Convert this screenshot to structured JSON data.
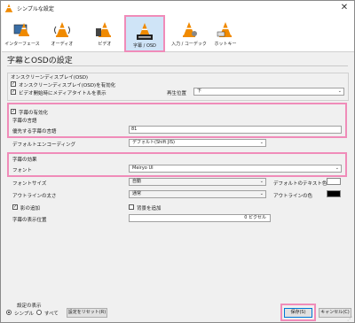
{
  "window": {
    "title": "シンプルな設定"
  },
  "toolbar": {
    "items": [
      {
        "label": "インターフェース"
      },
      {
        "label": "オーディオ"
      },
      {
        "label": "ビデオ"
      },
      {
        "label": "字幕 / OSD"
      },
      {
        "label": "入力 / コーデック"
      },
      {
        "label": "ホットキー"
      }
    ],
    "active_index": 3
  },
  "page": {
    "heading": "字幕とOSDの設定"
  },
  "osd": {
    "group_title": "オンスクリーンディスプレイ(OSD)",
    "enable_osd": "オンスクリーンディスプレイ(OSD)を有効化",
    "show_title": "ビデオ開始時にメディアタイトルを表示",
    "position_label": "再生位置",
    "position_value": "下"
  },
  "subtitles": {
    "enable": "字幕の有効化",
    "language_group": "字幕の言語",
    "preferred_label": "優先する字幕の言語",
    "preferred_value": "81",
    "encoding_label": "デフォルトエンコーディング",
    "encoding_value": "デフォルト(Shift JIS)"
  },
  "effects": {
    "group_title": "字幕の効果",
    "font_label": "フォント",
    "font_value": "Meiryo UI",
    "font_size_label": "フォントサイズ",
    "font_size_value": "自動",
    "text_color_label": "デフォルトのテキスト色",
    "outline_width_label": "アウトラインの太さ",
    "outline_width_value": "通常",
    "outline_color_label": "アウトラインの色",
    "shadow_label": "影の追加",
    "background_label": "背景を追加",
    "position_label": "字幕の表示位置",
    "position_value": "0 ピクセル"
  },
  "colors": {
    "text_color": "#ffffff",
    "outline_color": "#000000",
    "highlight": "#f08cb9",
    "active_tab": "#cfe4f7"
  },
  "footer": {
    "show_settings_label": "設定の表示",
    "simple": "シンプル",
    "all": "すべて",
    "reset": "設定をリセット(R)",
    "save": "保存(S)",
    "cancel": "キャンセル(C)"
  }
}
